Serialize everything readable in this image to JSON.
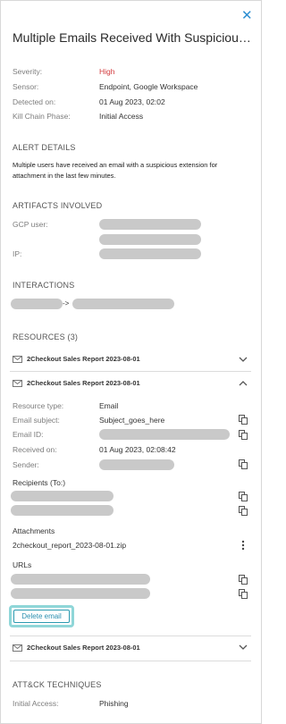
{
  "alert": {
    "title": "Multiple Emails Received With Suspicious Extension",
    "close_icon": "close-icon",
    "fields": [
      {
        "label": "Severity:",
        "value": "High"
      },
      {
        "label": "Sensor:",
        "value": "Endpoint, Google Workspace"
      },
      {
        "label": "Detected on:",
        "value": "01 Aug 2023, 02:02"
      },
      {
        "label": "Kill Chain Phase:",
        "value": "Initial Access"
      }
    ]
  },
  "alert_details": {
    "heading": "ALERT DETAILS",
    "description": "Multiple users have received an email with a suspicious extension for attachment in the last few minutes."
  },
  "artifacts": {
    "heading": "ARTIFACTS INVOLVED",
    "gcp_label": "GCP user:",
    "ip_label": "IP:"
  },
  "interactions": {
    "heading": "INTERACTIONS",
    "arrow": "->"
  },
  "resources": {
    "heading": "RESOURCES (3)",
    "items": [
      {
        "title": "2Checkout Sales Report 2023-08-01"
      },
      {
        "title": "2Checkout Sales Report 2023-08-01"
      },
      {
        "title": "2Checkout Sales Report 2023-08-01"
      }
    ],
    "expanded": {
      "resource_type_label": "Resource type:",
      "resource_type_value": "Email",
      "email_subject_label": "Email subject:",
      "email_subject_value": "Subject_goes_here",
      "email_id_label": "Email ID:",
      "received_on_label": "Received on:",
      "received_on_value": "01 Aug 2023, 02:08:42",
      "sender_label": "Sender:",
      "recipients_heading": "Recipients (To:)",
      "attachments_heading": "Attachments",
      "attachment_name": "2checkout_report_2023-08-01.zip",
      "urls_heading": "URLs",
      "delete_button": "Delete email"
    }
  },
  "attack": {
    "heading": "ATT&CK TECHNIQUES",
    "label": "Initial Access:",
    "value": "Phishing"
  },
  "colors": {
    "accent": "#2d8fd2",
    "severity_high": "#d2393c",
    "button_border": "#2b9ab0",
    "button_highlight": "#8fd6d8",
    "redaction": "#c9c9c9"
  }
}
